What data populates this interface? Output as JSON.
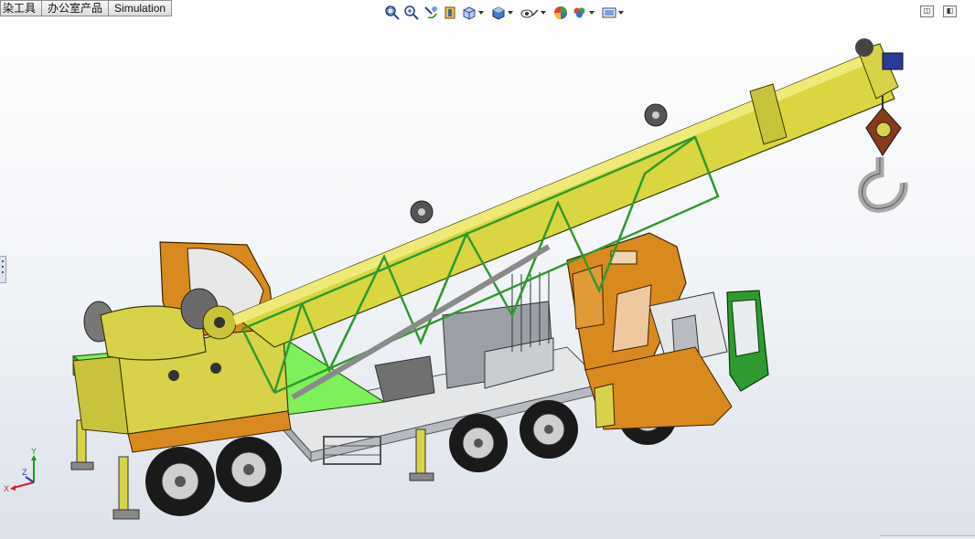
{
  "tabs": [
    "染工具",
    "办公室产品",
    "Simulation"
  ],
  "view_toolbar": {
    "icons": [
      "zoom-to-fit-icon",
      "zoom-to-area-icon",
      "previous-view-icon",
      "section-view-icon",
      "view-orientation-icon",
      "display-style-icon",
      "hide-show-items-icon",
      "edit-appearance-icon",
      "apply-scene-icon",
      "view-settings-icon"
    ]
  },
  "window_controls": {
    "restore_glyph": "◫",
    "close_glyph": "◧"
  },
  "triad": {
    "x_label": "X",
    "y_label": "Y",
    "z_label": "Z"
  },
  "colors": {
    "boom": "#d9d642",
    "truss": "#2f9a2f",
    "platform": "#7df05c",
    "cab": "#d98a1e",
    "chassis": "#cfd2d6",
    "tire": "#1a1a1a",
    "hook": "#a8a8a8"
  }
}
